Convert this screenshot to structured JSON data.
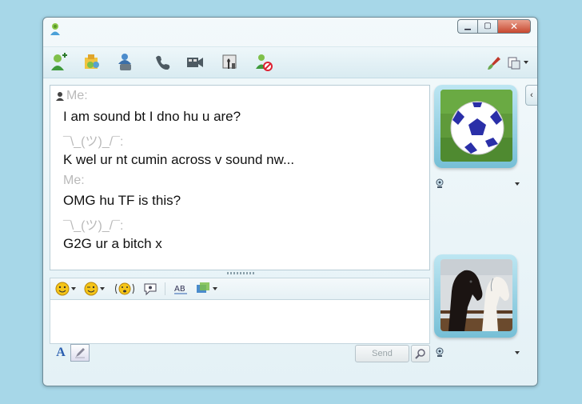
{
  "window": {
    "controls": {
      "minimize_icon": "minimize-icon",
      "maximize_icon": "maximize-icon",
      "close_icon": "close-icon"
    }
  },
  "toolbar": {
    "left_icons": [
      "invite-contact-icon",
      "share-files-icon",
      "call-contact-icon",
      "phone-icon",
      "video-call-icon",
      "games-icon",
      "block-contact-icon"
    ],
    "right_icons": [
      "paint-brush-icon",
      "menu-icon"
    ]
  },
  "conversation": {
    "messages": [
      {
        "sender": "Me:",
        "text": " I am sound bt I dno hu u are?"
      },
      {
        "sender": "¯\\_(ツ)_/¯:",
        "text": "K wel ur nt cumin across v sound nw..."
      },
      {
        "sender": "Me:",
        "text": "OMG hu TF is this?"
      },
      {
        "sender": "¯\\_(ツ)_/¯:",
        "text": "G2G ur a bitch x"
      }
    ]
  },
  "compose": {
    "toolbar_icons": [
      "emoticon-icon",
      "wink-icon",
      "nudge-icon",
      "voice-clip-icon",
      "font-icon",
      "background-icon"
    ],
    "text_value": "",
    "font_label": "A",
    "send_label": "Send"
  },
  "display_pictures": {
    "contact": "soccer-ball",
    "self": "horses"
  },
  "colors": {
    "background": "#a7d7e8",
    "window_frame": "#e4f1f6",
    "sender_text": "#b9b9b9",
    "close_button": "#c7482f",
    "avatar_frame": "#76bfd6"
  }
}
